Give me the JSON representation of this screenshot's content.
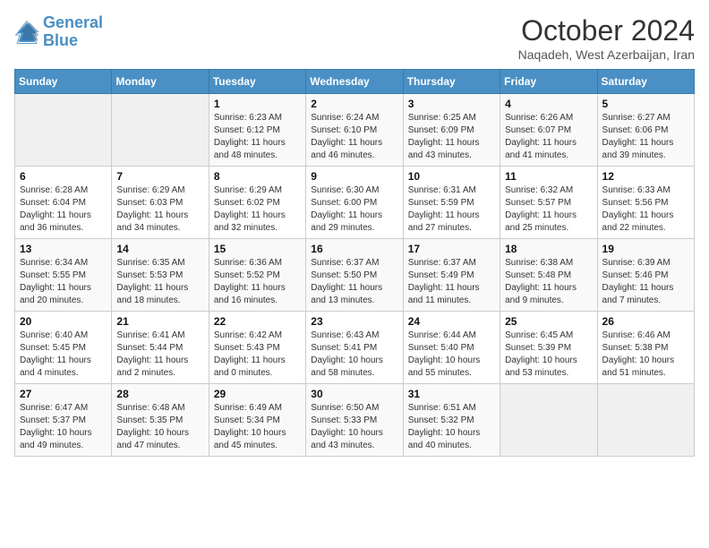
{
  "header": {
    "logo_line1": "General",
    "logo_line2": "Blue",
    "month": "October 2024",
    "location": "Naqadeh, West Azerbaijan, Iran"
  },
  "days_of_week": [
    "Sunday",
    "Monday",
    "Tuesday",
    "Wednesday",
    "Thursday",
    "Friday",
    "Saturday"
  ],
  "weeks": [
    [
      {
        "day": "",
        "info": ""
      },
      {
        "day": "",
        "info": ""
      },
      {
        "day": "1",
        "info": "Sunrise: 6:23 AM\nSunset: 6:12 PM\nDaylight: 11 hours and 48 minutes."
      },
      {
        "day": "2",
        "info": "Sunrise: 6:24 AM\nSunset: 6:10 PM\nDaylight: 11 hours and 46 minutes."
      },
      {
        "day": "3",
        "info": "Sunrise: 6:25 AM\nSunset: 6:09 PM\nDaylight: 11 hours and 43 minutes."
      },
      {
        "day": "4",
        "info": "Sunrise: 6:26 AM\nSunset: 6:07 PM\nDaylight: 11 hours and 41 minutes."
      },
      {
        "day": "5",
        "info": "Sunrise: 6:27 AM\nSunset: 6:06 PM\nDaylight: 11 hours and 39 minutes."
      }
    ],
    [
      {
        "day": "6",
        "info": "Sunrise: 6:28 AM\nSunset: 6:04 PM\nDaylight: 11 hours and 36 minutes."
      },
      {
        "day": "7",
        "info": "Sunrise: 6:29 AM\nSunset: 6:03 PM\nDaylight: 11 hours and 34 minutes."
      },
      {
        "day": "8",
        "info": "Sunrise: 6:29 AM\nSunset: 6:02 PM\nDaylight: 11 hours and 32 minutes."
      },
      {
        "day": "9",
        "info": "Sunrise: 6:30 AM\nSunset: 6:00 PM\nDaylight: 11 hours and 29 minutes."
      },
      {
        "day": "10",
        "info": "Sunrise: 6:31 AM\nSunset: 5:59 PM\nDaylight: 11 hours and 27 minutes."
      },
      {
        "day": "11",
        "info": "Sunrise: 6:32 AM\nSunset: 5:57 PM\nDaylight: 11 hours and 25 minutes."
      },
      {
        "day": "12",
        "info": "Sunrise: 6:33 AM\nSunset: 5:56 PM\nDaylight: 11 hours and 22 minutes."
      }
    ],
    [
      {
        "day": "13",
        "info": "Sunrise: 6:34 AM\nSunset: 5:55 PM\nDaylight: 11 hours and 20 minutes."
      },
      {
        "day": "14",
        "info": "Sunrise: 6:35 AM\nSunset: 5:53 PM\nDaylight: 11 hours and 18 minutes."
      },
      {
        "day": "15",
        "info": "Sunrise: 6:36 AM\nSunset: 5:52 PM\nDaylight: 11 hours and 16 minutes."
      },
      {
        "day": "16",
        "info": "Sunrise: 6:37 AM\nSunset: 5:50 PM\nDaylight: 11 hours and 13 minutes."
      },
      {
        "day": "17",
        "info": "Sunrise: 6:37 AM\nSunset: 5:49 PM\nDaylight: 11 hours and 11 minutes."
      },
      {
        "day": "18",
        "info": "Sunrise: 6:38 AM\nSunset: 5:48 PM\nDaylight: 11 hours and 9 minutes."
      },
      {
        "day": "19",
        "info": "Sunrise: 6:39 AM\nSunset: 5:46 PM\nDaylight: 11 hours and 7 minutes."
      }
    ],
    [
      {
        "day": "20",
        "info": "Sunrise: 6:40 AM\nSunset: 5:45 PM\nDaylight: 11 hours and 4 minutes."
      },
      {
        "day": "21",
        "info": "Sunrise: 6:41 AM\nSunset: 5:44 PM\nDaylight: 11 hours and 2 minutes."
      },
      {
        "day": "22",
        "info": "Sunrise: 6:42 AM\nSunset: 5:43 PM\nDaylight: 11 hours and 0 minutes."
      },
      {
        "day": "23",
        "info": "Sunrise: 6:43 AM\nSunset: 5:41 PM\nDaylight: 10 hours and 58 minutes."
      },
      {
        "day": "24",
        "info": "Sunrise: 6:44 AM\nSunset: 5:40 PM\nDaylight: 10 hours and 55 minutes."
      },
      {
        "day": "25",
        "info": "Sunrise: 6:45 AM\nSunset: 5:39 PM\nDaylight: 10 hours and 53 minutes."
      },
      {
        "day": "26",
        "info": "Sunrise: 6:46 AM\nSunset: 5:38 PM\nDaylight: 10 hours and 51 minutes."
      }
    ],
    [
      {
        "day": "27",
        "info": "Sunrise: 6:47 AM\nSunset: 5:37 PM\nDaylight: 10 hours and 49 minutes."
      },
      {
        "day": "28",
        "info": "Sunrise: 6:48 AM\nSunset: 5:35 PM\nDaylight: 10 hours and 47 minutes."
      },
      {
        "day": "29",
        "info": "Sunrise: 6:49 AM\nSunset: 5:34 PM\nDaylight: 10 hours and 45 minutes."
      },
      {
        "day": "30",
        "info": "Sunrise: 6:50 AM\nSunset: 5:33 PM\nDaylight: 10 hours and 43 minutes."
      },
      {
        "day": "31",
        "info": "Sunrise: 6:51 AM\nSunset: 5:32 PM\nDaylight: 10 hours and 40 minutes."
      },
      {
        "day": "",
        "info": ""
      },
      {
        "day": "",
        "info": ""
      }
    ]
  ]
}
